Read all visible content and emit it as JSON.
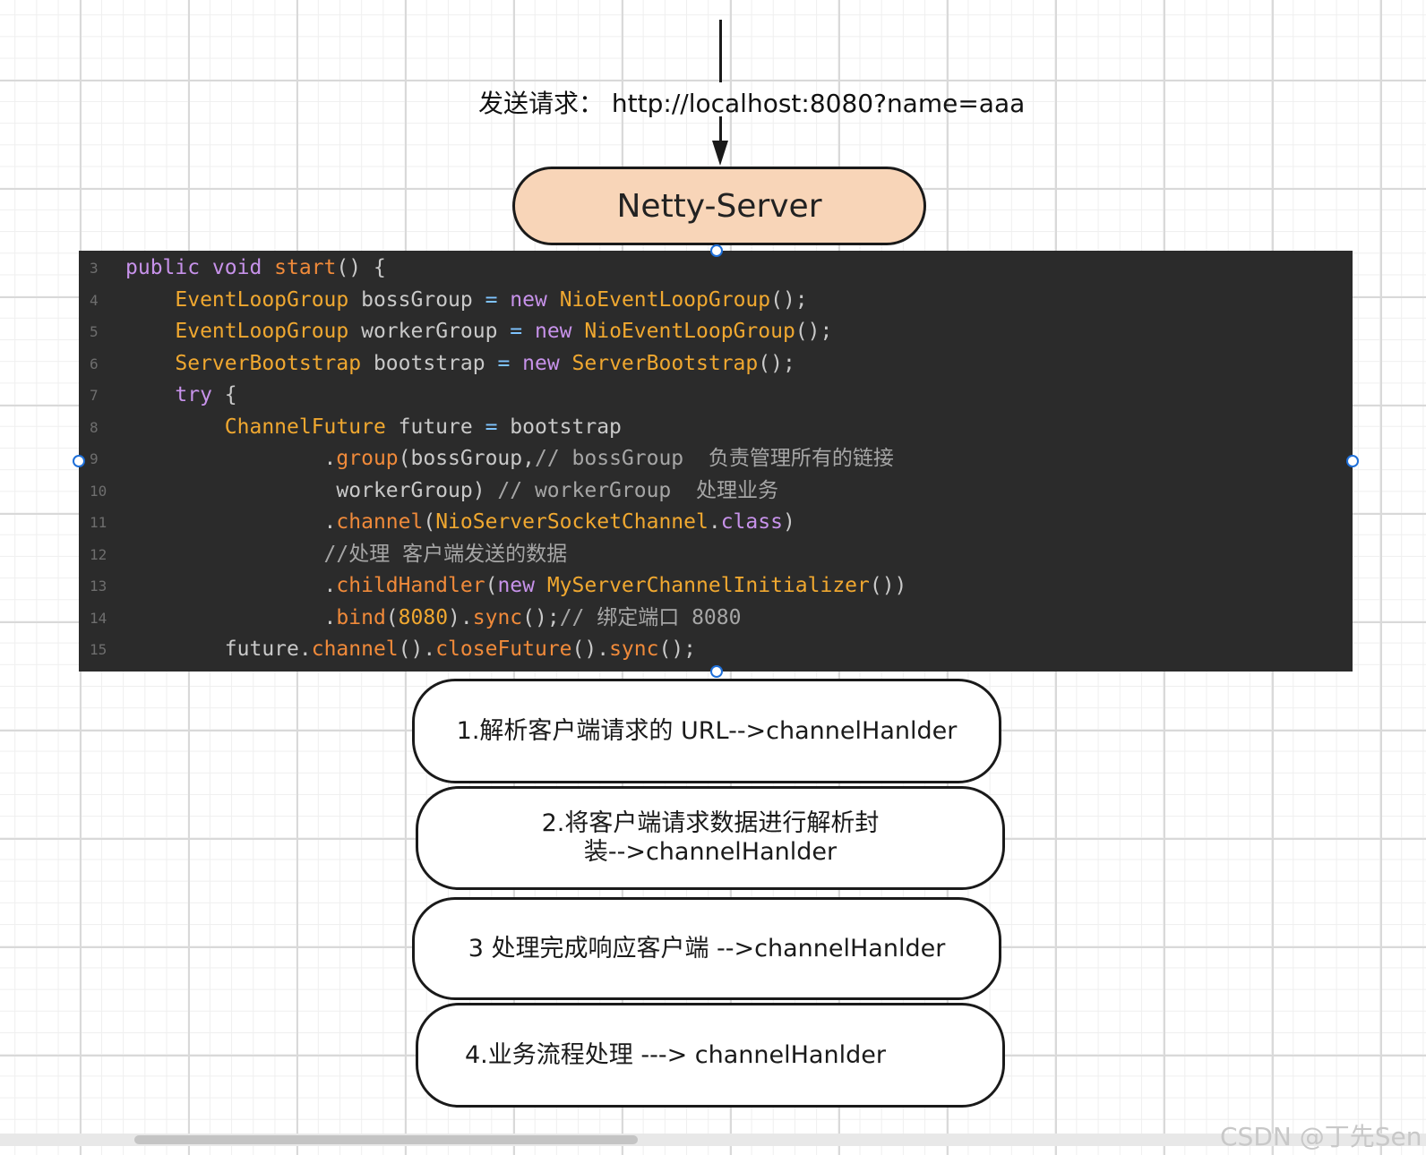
{
  "request": {
    "label": "发送请求：",
    "url": "http://localhost:8080?name=aaa"
  },
  "server": {
    "label": "Netty-Server"
  },
  "code": {
    "lines": [
      {
        "num": "3",
        "tokens": [
          [
            "kw",
            "public void "
          ],
          [
            "fn",
            "start"
          ],
          [
            "",
            "() {"
          ]
        ]
      },
      {
        "num": "4",
        "tokens": [
          [
            "",
            "    "
          ],
          [
            "ty",
            "EventLoopGroup"
          ],
          [
            "",
            " bossGroup "
          ],
          [
            "op",
            "="
          ],
          [
            "kw",
            " new "
          ],
          [
            "ty",
            "NioEventLoopGroup"
          ],
          [
            "",
            "();"
          ]
        ]
      },
      {
        "num": "5",
        "tokens": [
          [
            "",
            "    "
          ],
          [
            "ty",
            "EventLoopGroup"
          ],
          [
            "",
            " workerGroup "
          ],
          [
            "op",
            "="
          ],
          [
            "kw",
            " new "
          ],
          [
            "ty",
            "NioEventLoopGroup"
          ],
          [
            "",
            "();"
          ]
        ]
      },
      {
        "num": "6",
        "tokens": [
          [
            "",
            "    "
          ],
          [
            "ty",
            "ServerBootstrap"
          ],
          [
            "",
            " bootstrap "
          ],
          [
            "op",
            "="
          ],
          [
            "kw",
            " new "
          ],
          [
            "ty",
            "ServerBootstrap"
          ],
          [
            "",
            "();"
          ]
        ]
      },
      {
        "num": "7",
        "tokens": [
          [
            "",
            "    "
          ],
          [
            "kw",
            "try"
          ],
          [
            "",
            " {"
          ]
        ]
      },
      {
        "num": "8",
        "tokens": [
          [
            "",
            "        "
          ],
          [
            "ty",
            "ChannelFuture"
          ],
          [
            "",
            " future "
          ],
          [
            "op",
            "="
          ],
          [
            "",
            " bootstrap"
          ]
        ]
      },
      {
        "num": "9",
        "tokens": [
          [
            "",
            "                ."
          ],
          [
            "fn",
            "group"
          ],
          [
            "",
            "(bossGroup,"
          ],
          [
            "cm",
            "// bossGroup  负责管理所有的链接"
          ]
        ]
      },
      {
        "num": "10",
        "tokens": [
          [
            "",
            "                 workerGroup) "
          ],
          [
            "cm",
            "// workerGroup  处理业务"
          ]
        ]
      },
      {
        "num": "11",
        "tokens": [
          [
            "",
            "                ."
          ],
          [
            "fn",
            "channel"
          ],
          [
            "",
            "("
          ],
          [
            "ty",
            "NioServerSocketChannel"
          ],
          [
            "",
            "."
          ],
          [
            "kw",
            "class"
          ],
          [
            "",
            ")"
          ]
        ]
      },
      {
        "num": "12",
        "tokens": [
          [
            "cm",
            "                //处理 客户端发送的数据"
          ]
        ]
      },
      {
        "num": "13",
        "tokens": [
          [
            "",
            "                ."
          ],
          [
            "fn",
            "childHandler"
          ],
          [
            "",
            "("
          ],
          [
            "kw",
            "new"
          ],
          [
            "ty",
            " MyServerChannelInitializer"
          ],
          [
            "",
            "())"
          ]
        ]
      },
      {
        "num": "14",
        "tokens": [
          [
            "",
            "                ."
          ],
          [
            "fn",
            "bind"
          ],
          [
            "",
            "("
          ],
          [
            "ty",
            "8080"
          ],
          [
            "",
            ")."
          ],
          [
            "fn",
            "sync"
          ],
          [
            "",
            "();"
          ],
          [
            "cm",
            "// 绑定端口 8080"
          ]
        ]
      },
      {
        "num": "15",
        "tokens": [
          [
            "",
            "        future."
          ],
          [
            "fn",
            "channel"
          ],
          [
            "",
            "()."
          ],
          [
            "fn",
            "closeFuture"
          ],
          [
            "",
            "()."
          ],
          [
            "fn",
            "sync"
          ],
          [
            "",
            "();"
          ]
        ]
      }
    ]
  },
  "steps": [
    {
      "text": "1.解析客户端请求的 URL-->channelHanlder"
    },
    {
      "text": "2.将客户端请求数据进行解析封装-->channelHanlder"
    },
    {
      "text": "3 处理完成响应客户端 -->channelHanlder"
    },
    {
      "text": "4.业务流程处理 ---> channelHanlder"
    }
  ],
  "watermark": "CSDN @丁先Sen",
  "colors": {
    "server_fill": "#f8d5b8",
    "code_bg": "#2b2b2b",
    "keyword": "#c792ea",
    "type": "#f0a830",
    "function": "#f08a3a",
    "operator": "#7fc4ff",
    "comment": "#a6a6a6",
    "handle": "#1e6fd9"
  }
}
